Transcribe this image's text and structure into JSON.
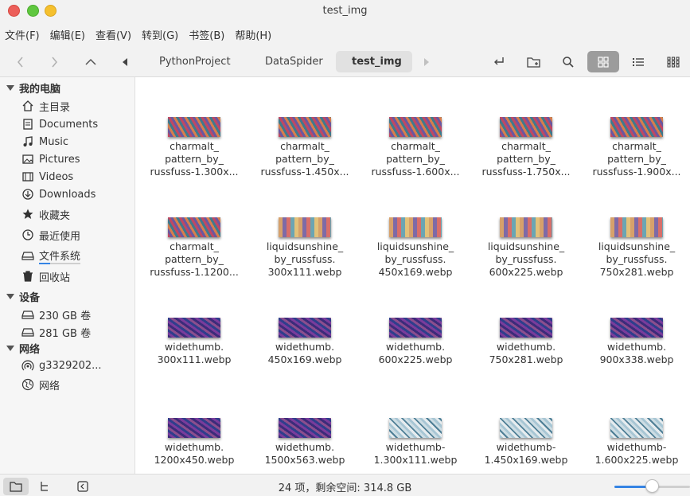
{
  "window": {
    "title": "test_img"
  },
  "menu": [
    "文件(F)",
    "编辑(E)",
    "查看(V)",
    "转到(G)",
    "书签(B)",
    "帮助(H)"
  ],
  "breadcrumbs": [
    "PythonProject",
    "DataSpider",
    "test_img"
  ],
  "sidebar": {
    "sections": [
      {
        "label": "我的电脑"
      },
      {
        "label": "设备"
      },
      {
        "label": "网络"
      }
    ],
    "items": [
      {
        "label": "主目录",
        "icon": "home-icon"
      },
      {
        "label": "Documents",
        "icon": "documents-icon"
      },
      {
        "label": "Music",
        "icon": "music-icon"
      },
      {
        "label": "Pictures",
        "icon": "pictures-icon"
      },
      {
        "label": "Videos",
        "icon": "videos-icon"
      },
      {
        "label": "Downloads",
        "icon": "downloads-icon"
      },
      {
        "label": "收藏夹",
        "icon": "star-icon"
      },
      {
        "label": "最近使用",
        "icon": "clock-icon"
      },
      {
        "label": "文件系统",
        "icon": "drive-icon"
      },
      {
        "label": "回收站",
        "icon": "trash-icon"
      },
      {
        "label": "230 GB 卷",
        "icon": "drive-icon"
      },
      {
        "label": "281 GB 卷",
        "icon": "drive-icon"
      },
      {
        "label": "g3329202...",
        "icon": "network-share-icon"
      },
      {
        "label": "网络",
        "icon": "globe-icon"
      }
    ]
  },
  "files": [
    {
      "name": "charmalt_\npattern_by_\nrussfuss-1.300x...",
      "thumb": "charmalt"
    },
    {
      "name": "charmalt_\npattern_by_\nrussfuss-1.450x...",
      "thumb": "charmalt"
    },
    {
      "name": "charmalt_\npattern_by_\nrussfuss-1.600x...",
      "thumb": "charmalt"
    },
    {
      "name": "charmalt_\npattern_by_\nrussfuss-1.750x...",
      "thumb": "charmalt"
    },
    {
      "name": "charmalt_\npattern_by_\nrussfuss-1.900x...",
      "thumb": "charmalt"
    },
    {
      "name": "charmalt_\npattern_by_\nrussfuss-1.1200...",
      "thumb": "charmalt"
    },
    {
      "name": "liquidsunshine_\nby_russfuss.\n300x111.webp",
      "thumb": "liquid"
    },
    {
      "name": "liquidsunshine_\nby_russfuss.\n450x169.webp",
      "thumb": "liquid"
    },
    {
      "name": "liquidsunshine_\nby_russfuss.\n600x225.webp",
      "thumb": "liquid"
    },
    {
      "name": "liquidsunshine_\nby_russfuss.\n750x281.webp",
      "thumb": "liquid"
    },
    {
      "name": "widethumb.\n300x111.webp",
      "thumb": "wide"
    },
    {
      "name": "widethumb.\n450x169.webp",
      "thumb": "wide"
    },
    {
      "name": "widethumb.\n600x225.webp",
      "thumb": "wide"
    },
    {
      "name": "widethumb.\n750x281.webp",
      "thumb": "wide"
    },
    {
      "name": "widethumb.\n900x338.webp",
      "thumb": "wide"
    },
    {
      "name": "widethumb.\n1200x450.webp",
      "thumb": "wide"
    },
    {
      "name": "widethumb.\n1500x563.webp",
      "thumb": "wide"
    },
    {
      "name": "widethumb-\n1.300x111.webp",
      "thumb": "wideice"
    },
    {
      "name": "widethumb-\n1.450x169.webp",
      "thumb": "wideice"
    },
    {
      "name": "widethumb-\n1.600x225.webp",
      "thumb": "wideice"
    }
  ],
  "status": {
    "text": "24 项，剩余空间: 314.8 GB",
    "zoom_level": 0.5
  },
  "colors": {
    "accent": "#3584e4",
    "close": "#ec5f5a",
    "maximize": "#5fc73f",
    "minimize": "#f5c02e"
  }
}
